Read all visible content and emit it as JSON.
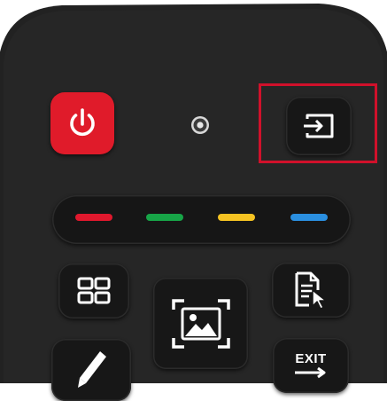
{
  "remote": {
    "buttons": {
      "power": {
        "icon": "power-icon",
        "color": "#e01b2a"
      },
      "indicator": {
        "icon": "led-indicator-icon"
      },
      "source": {
        "icon": "input-source-icon",
        "highlighted": true,
        "highlight_color": "#d0112b"
      },
      "color_keys": [
        {
          "name": "red",
          "color": "#e0182d"
        },
        {
          "name": "green",
          "color": "#17a547"
        },
        {
          "name": "yellow",
          "color": "#f6c322"
        },
        {
          "name": "blue",
          "color": "#2a8fe0"
        }
      ],
      "menu": {
        "icon": "windows-grid-icon"
      },
      "picture": {
        "icon": "picture-icon"
      },
      "document": {
        "icon": "document-cursor-icon"
      },
      "pen": {
        "icon": "pen-icon"
      },
      "exit": {
        "label": "EXIT",
        "icon": "arrow-right-icon"
      }
    }
  }
}
